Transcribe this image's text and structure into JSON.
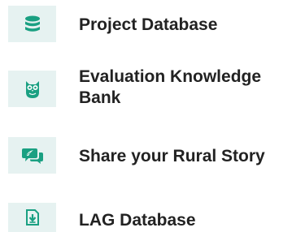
{
  "colors": {
    "icon_background": "#e6f2f1",
    "icon_color": "#1aa082",
    "label_color": "#222222"
  },
  "menu": {
    "items": [
      {
        "label": "Project Database",
        "icon": "database-icon"
      },
      {
        "label_line1": "Evaluation Knowledge",
        "label_line2": "Bank",
        "icon": "owl-icon"
      },
      {
        "label": "Share your Rural Story",
        "icon": "speech-bubbles-icon"
      },
      {
        "label": "LAG Database",
        "icon": "download-document-icon"
      }
    ]
  }
}
